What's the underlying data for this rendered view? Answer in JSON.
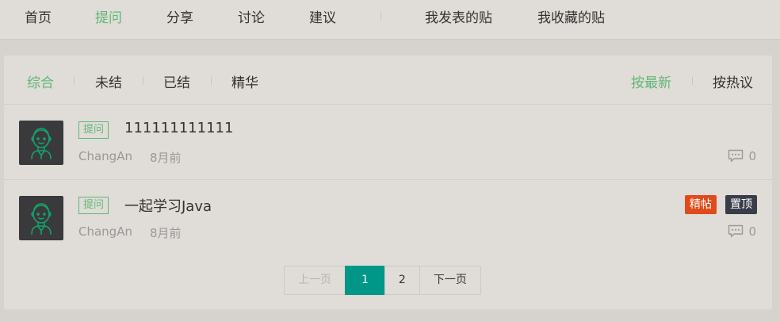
{
  "nav": {
    "items": [
      "首页",
      "提问",
      "分享",
      "讨论",
      "建议"
    ],
    "active_index": 1,
    "my_posts": "我发表的贴",
    "my_favorites": "我收藏的贴"
  },
  "filters": {
    "left": [
      "综合",
      "未结",
      "已结",
      "精华"
    ],
    "right": [
      "按最新",
      "按热议"
    ],
    "active_left": 0,
    "active_right": 0
  },
  "posts": [
    {
      "tag": "提问",
      "title": "111111111111",
      "author": "ChangAn",
      "time": "8月前",
      "replies": "0"
    },
    {
      "tag": "提问",
      "title": "一起学习Java",
      "author": "ChangAn",
      "time": "8月前",
      "replies": "0",
      "badge_essence": "精帖",
      "badge_top": "置顶"
    }
  ],
  "pager": {
    "prev": "上一页",
    "pages": [
      "1",
      "2"
    ],
    "current": "1",
    "next": "下一页"
  },
  "colors": {
    "accent": "#5FB878",
    "pager_active": "#009688",
    "essence": "#e04b1b",
    "top": "#393D49"
  }
}
